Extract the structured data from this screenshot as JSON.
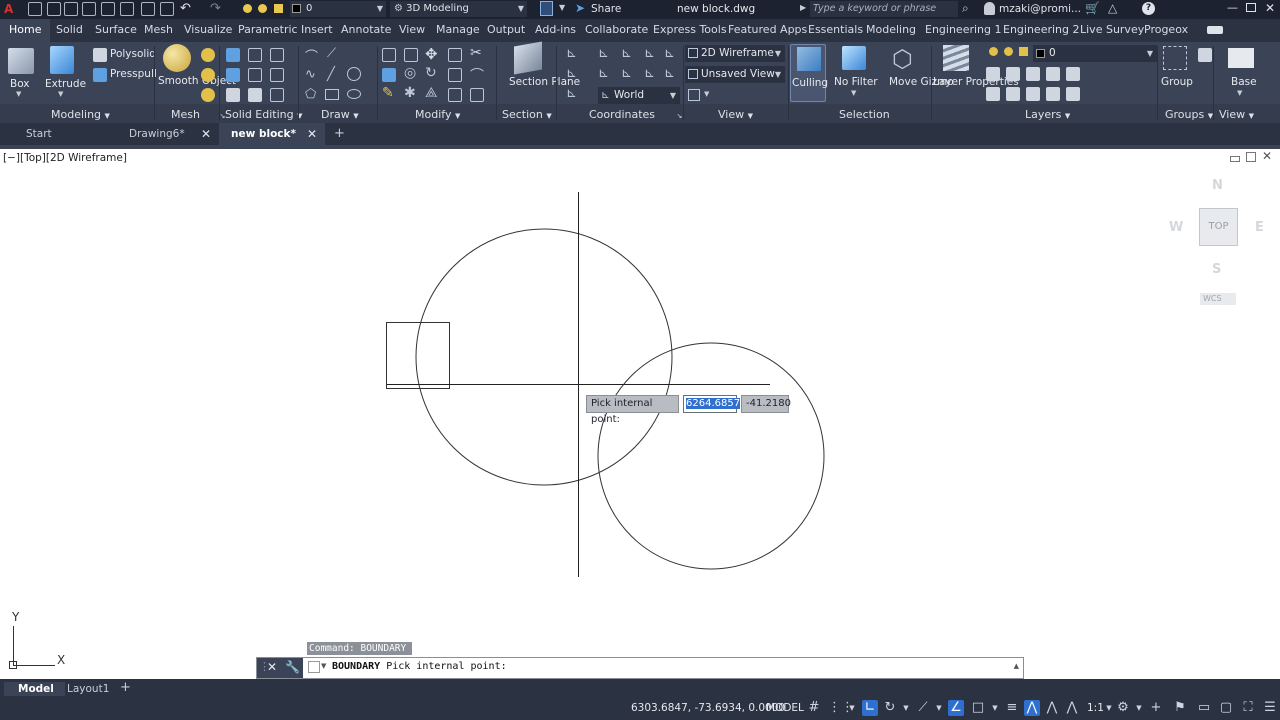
{
  "app": {
    "file_title": "new block.dwg",
    "workspace": "3D Modeling",
    "layer_quick": "0",
    "search_placeholder": "Type a keyword or phrase",
    "user": "mzaki@promi..."
  },
  "ribbon_tabs": [
    "Home",
    "Solid",
    "Surface",
    "Mesh",
    "Visualize",
    "Parametric",
    "Insert",
    "Annotate",
    "View",
    "Manage",
    "Output",
    "Add-ins",
    "Collaborate",
    "Express Tools",
    "Featured Apps",
    "Essentials",
    "Modeling",
    "Engineering 1",
    "Engineering 2",
    "Live Survey",
    "Progeox"
  ],
  "share_label": "Share",
  "panels": {
    "modeling": "Modeling",
    "mesh": "Mesh",
    "solid_editing": "Solid Editing",
    "draw": "Draw",
    "modify": "Modify",
    "section": "Section",
    "coordinates": "Coordinates",
    "view": "View",
    "selection": "Selection",
    "layers": "Layers",
    "groups": "Groups",
    "view2": "View"
  },
  "buttons": {
    "box": "Box",
    "extrude": "Extrude",
    "polysolid": "Polysolid",
    "presspull": "Presspull",
    "smooth_object": "Smooth Object",
    "section_plane": "Section Plane",
    "culling": "Culling",
    "no_filter": "No Filter",
    "move_gizmo": "Move Gizmo",
    "layer_properties": "Layer Properties",
    "group": "Group",
    "base": "Base"
  },
  "dropdowns": {
    "visual_style": "2D Wireframe",
    "named_view": "Unsaved View",
    "ucs": "World",
    "layer": "0"
  },
  "doc_tabs": [
    "Start",
    "Drawing6*",
    "new block*"
  ],
  "viewport_label": "[−][Top][2D Wireframe]",
  "viewcube": {
    "face": "TOP",
    "n": "N",
    "s": "S",
    "e": "E",
    "w": "W",
    "wcs": "WCS"
  },
  "ucs_icon": {
    "x": "X",
    "y": "Y"
  },
  "dynamic_input": {
    "prompt": "Pick internal point:",
    "x_value": "6264.6857",
    "y_value": "-41.2180"
  },
  "command": {
    "history": "Command: BOUNDARY",
    "current_cmd": "BOUNDARY",
    "current_prompt": "Pick internal point:"
  },
  "layout_tabs": [
    "Model",
    "Layout1"
  ],
  "status": {
    "coordinates": "6303.6847, -73.6934, 0.0000",
    "space": "MODEL",
    "scale": "1:1"
  }
}
